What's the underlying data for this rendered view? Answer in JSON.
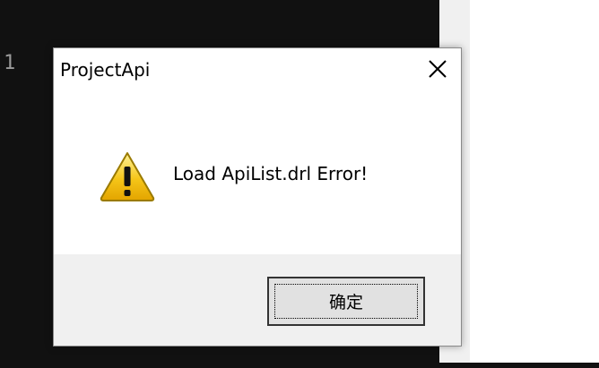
{
  "editor": {
    "line_number": "1"
  },
  "dialog": {
    "title": "ProjectApi",
    "message": "Load ApiList.drl Error!",
    "icon": "warning-icon",
    "close_icon": "close-icon",
    "ok_label": "确定"
  },
  "colors": {
    "dialog_background": "#ffffff",
    "footer_background": "#f0f0f0",
    "button_background": "#e1e1e1",
    "warning_yellow": "#f5c518",
    "editor_background": "#111111"
  }
}
